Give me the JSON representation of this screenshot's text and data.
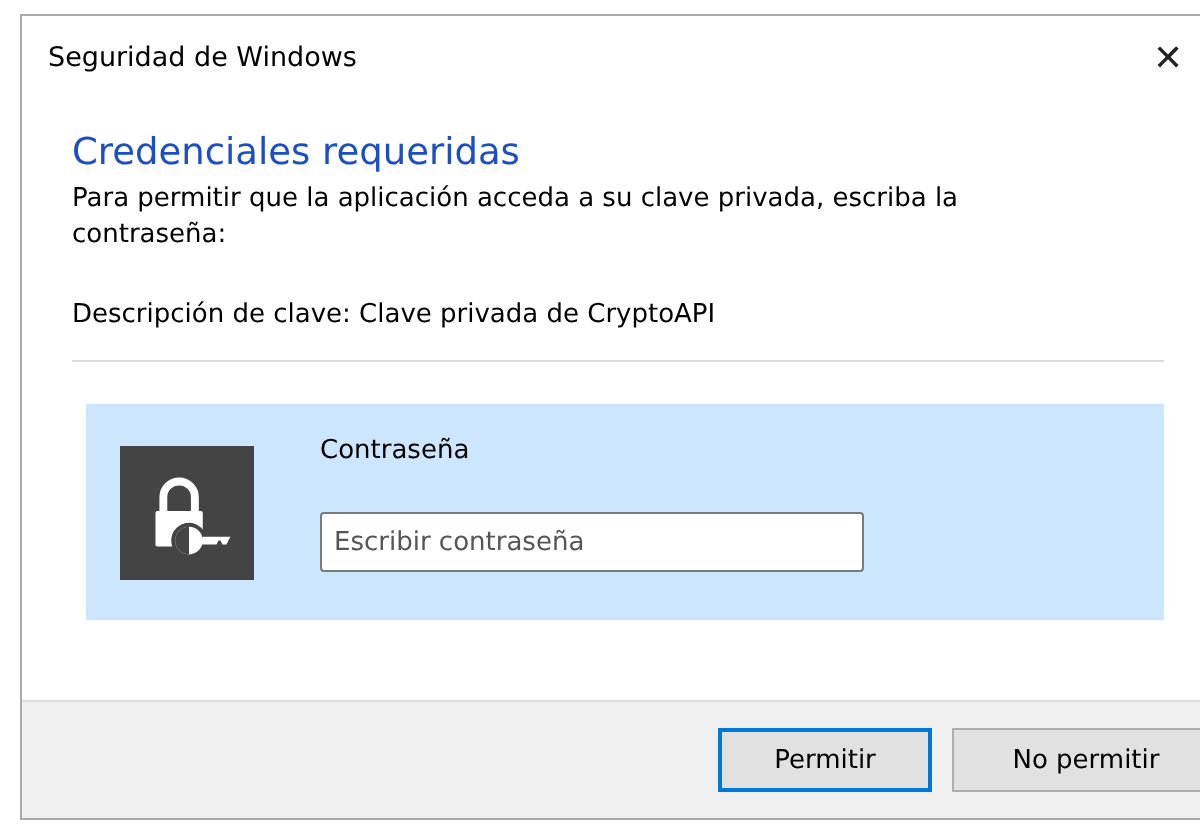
{
  "window": {
    "title": "Seguridad de Windows",
    "close": "✕"
  },
  "heading": "Credenciales requeridas",
  "message": "Para permitir que la aplicación acceda a su clave privada, escriba la contraseña:",
  "key_description": "Descripción de clave: Clave privada de CryptoAPI",
  "credential": {
    "label": "Contraseña",
    "placeholder": "Escribir contraseña"
  },
  "buttons": [
    {
      "label": "Permitir",
      "default": true
    },
    {
      "label": "No permitir",
      "default": false
    }
  ]
}
